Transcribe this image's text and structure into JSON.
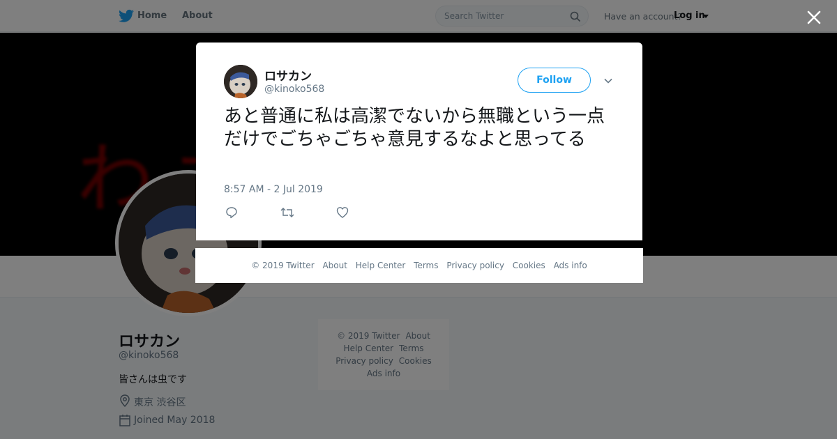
{
  "nav": {
    "home_label": "Home",
    "about_label": "About",
    "search_placeholder": "Search Twitter",
    "account_prompt": "Have an account?",
    "login_label": "Log in"
  },
  "banner": {
    "text": "わた る"
  },
  "profile": {
    "name": "ロサカン",
    "handle": "@kinoko568",
    "bio": "皆さんは虫です",
    "location": "東京 渋谷区",
    "joined": "Joined May 2018"
  },
  "side_footer": {
    "copyright": "© 2019 Twitter",
    "about": "About",
    "help": "Help Center",
    "terms": "Terms",
    "privacy": "Privacy policy",
    "cookies": "Cookies",
    "ads": "Ads info"
  },
  "tweet": {
    "name": "ロサカン",
    "handle": "@kinoko568",
    "follow_label": "Follow",
    "text": "あと普通に私は高潔でないから無職という一点だけでごちゃごちゃ意見するなよと思ってる",
    "timestamp": "8:57 AM - 2 Jul 2019"
  },
  "modal_footer": {
    "copyright": "© 2019 Twitter",
    "about": "About",
    "help": "Help Center",
    "terms": "Terms",
    "privacy": "Privacy policy",
    "cookies": "Cookies",
    "ads": "Ads info"
  },
  "colors": {
    "brand": "#1da1f2",
    "text": "#14171a",
    "muted": "#657786",
    "overlay": "rgba(0,0,0,0.5)"
  },
  "icons": [
    "twitter-bird-icon",
    "search-icon",
    "caret-down-icon",
    "close-icon",
    "chevron-down-icon",
    "reply-icon",
    "retweet-icon",
    "like-icon",
    "location-icon",
    "calendar-icon"
  ]
}
